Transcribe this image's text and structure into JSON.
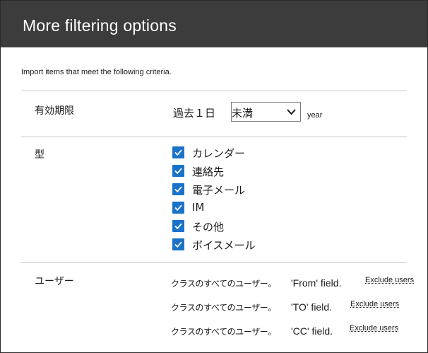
{
  "header": {
    "title": "More filtering options"
  },
  "intro": "Import items that meet the following criteria.",
  "expiry": {
    "label": "有効期限",
    "prefix": "過去１日",
    "select_value": "未満",
    "unit": "year"
  },
  "types": {
    "label": "型",
    "items": [
      {
        "label": "カレンダー",
        "checked": true
      },
      {
        "label": "連絡先",
        "checked": true
      },
      {
        "label": "電子メール",
        "checked": true
      },
      {
        "label": "IM",
        "checked": true
      },
      {
        "label": "その他",
        "checked": true
      },
      {
        "label": "ボイスメール",
        "checked": true
      }
    ]
  },
  "users": {
    "label": "ユーザー",
    "rows": [
      {
        "scope": "クラスのすべてのユーザー。",
        "field": "'From' field.",
        "action": "Exclude users"
      },
      {
        "scope": "クラスのすべてのユーザー。",
        "field": "'TO' field.",
        "action": "Exclude users"
      },
      {
        "scope": "クラスのすべてのユーザー。",
        "field": "'CC' field.",
        "action": "Exclude users"
      }
    ]
  },
  "colors": {
    "header_bg": "#3c3c3c",
    "checkbox": "#1a73c8",
    "divider": "#c8c8c8"
  }
}
